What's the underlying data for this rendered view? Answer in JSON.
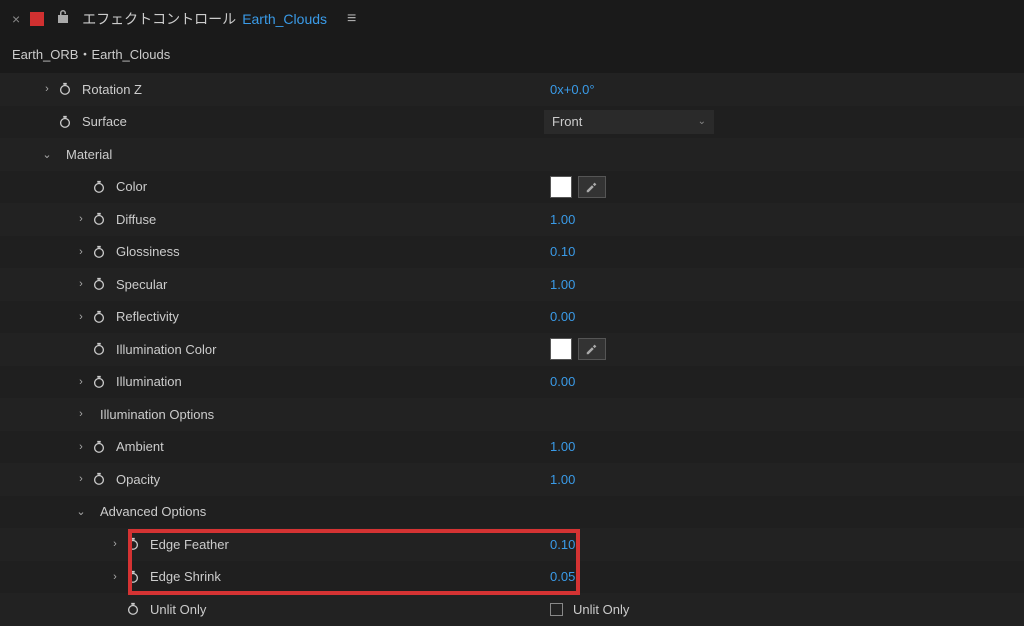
{
  "header": {
    "title": "エフェクトコントロール",
    "subtitle": "Earth_Clouds"
  },
  "breadcrumb": "Earth_ORB・Earth_Clouds",
  "rows": {
    "rotation_z": {
      "label": "Rotation Z",
      "value": "0x+0.0°"
    },
    "surface": {
      "label": "Surface",
      "value": "Front"
    },
    "material": {
      "label": "Material"
    },
    "color": {
      "label": "Color",
      "swatch": "#ffffff"
    },
    "diffuse": {
      "label": "Diffuse",
      "value": "1.00"
    },
    "glossiness": {
      "label": "Glossiness",
      "value": "0.10"
    },
    "specular": {
      "label": "Specular",
      "value": "1.00"
    },
    "reflectivity": {
      "label": "Reflectivity",
      "value": "0.00"
    },
    "illumination_color": {
      "label": "Illumination Color",
      "swatch": "#ffffff"
    },
    "illumination": {
      "label": "Illumination",
      "value": "0.00"
    },
    "illumination_options": {
      "label": "Illumination Options"
    },
    "ambient": {
      "label": "Ambient",
      "value": "1.00"
    },
    "opacity": {
      "label": "Opacity",
      "value": "1.00"
    },
    "advanced_options": {
      "label": "Advanced Options"
    },
    "edge_feather": {
      "label": "Edge Feather",
      "value": "0.10"
    },
    "edge_shrink": {
      "label": "Edge Shrink",
      "value": "0.05"
    },
    "unlit_only": {
      "label": "Unlit Only",
      "checkbox_label": "Unlit Only"
    }
  }
}
